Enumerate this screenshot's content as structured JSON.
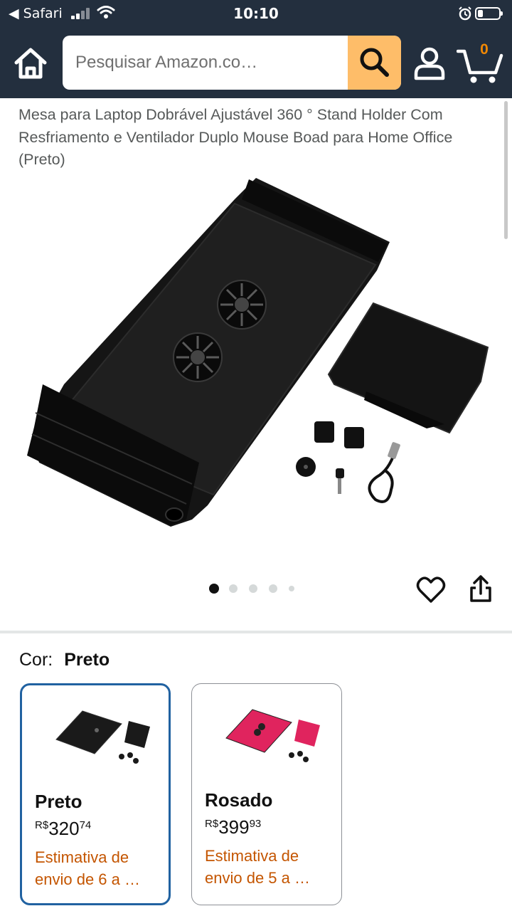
{
  "status_bar": {
    "back_label": "◀ Safari",
    "time": "10:10"
  },
  "header": {
    "search_placeholder": "Pesquisar Amazon.co…",
    "cart_count": "0"
  },
  "product": {
    "title": "Mesa para Laptop Dobrável Ajustável 360 ° Stand Holder Com Resfriamento e Ventilador Duplo Mouse Boad para Home Office (Preto)",
    "image_count": 5,
    "current_image": 1
  },
  "variants": {
    "label": "Cor:",
    "selected_value": "Preto",
    "options": [
      {
        "name": "Preto",
        "currency": "R$",
        "price_whole": "320",
        "price_cents": "74",
        "shipping": "Estimativa de envio de 6 a …",
        "selected": true,
        "color": "#1a1a1a"
      },
      {
        "name": "Rosado",
        "currency": "R$",
        "price_whole": "399",
        "price_cents": "93",
        "shipping": "Estimativa de envio de 5 a …",
        "selected": false,
        "color": "#e0245e"
      }
    ]
  },
  "colors": {
    "nav_bg": "#232f3e",
    "search_button": "#febd69",
    "cart_count": "#f08804",
    "selected_border": "#2162a1",
    "shipping_text": "#c45500"
  }
}
